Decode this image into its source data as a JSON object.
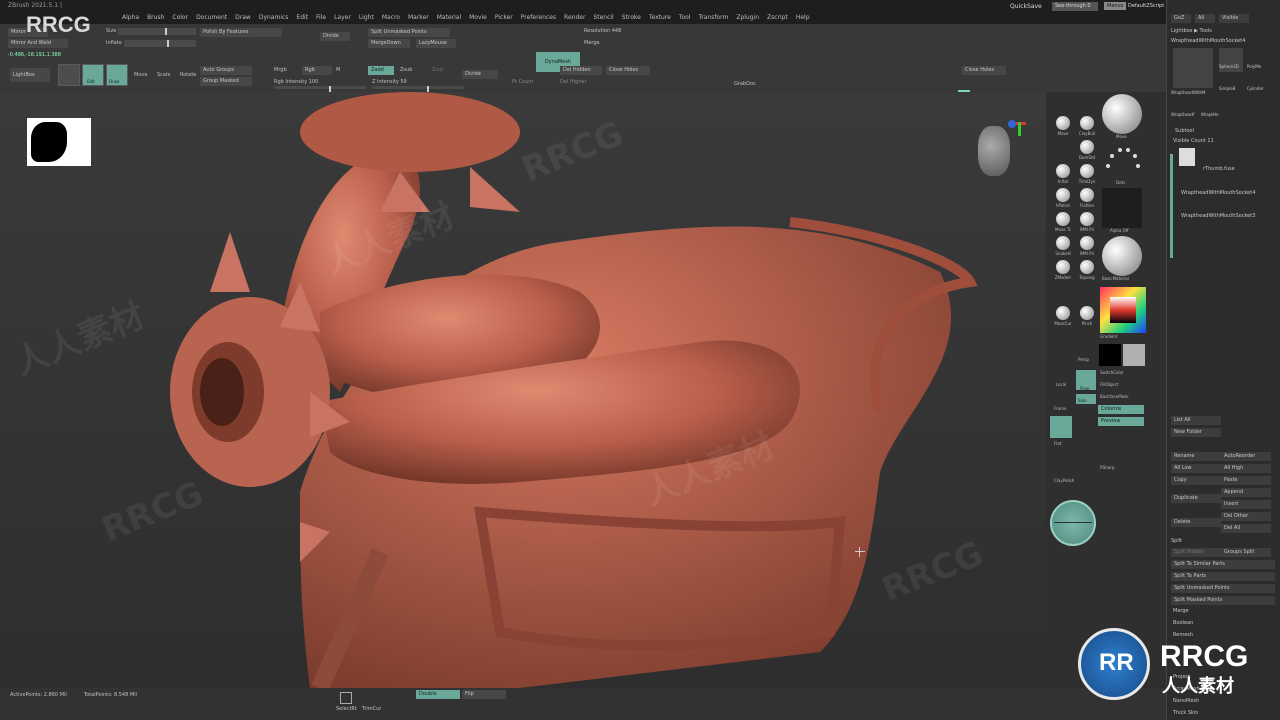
{
  "app": {
    "title": "ZBrush 2021.5.1 |",
    "logo": "RRCG"
  },
  "menus": [
    "Alpha",
    "Brush",
    "Color",
    "Document",
    "Draw",
    "Dynamics",
    "Edit",
    "File",
    "Layer",
    "Light",
    "Macro",
    "Marker",
    "Material",
    "Movie",
    "Picker",
    "Preferences",
    "Render",
    "Stencil",
    "Stroke",
    "Texture",
    "Tool",
    "Transform",
    "Zplugin",
    "Zscript",
    "Help"
  ],
  "header_right": {
    "ac": "AC",
    "quicksave": "QuickSave",
    "seethrough": "See-through  0",
    "menus": "Menus",
    "default_zscript": "DefaultZScript"
  },
  "toolbar": {
    "mirror": "Mirror",
    "mirror_weld": "Mirror And Weld",
    "size": "Size",
    "inflate": "Inflate",
    "polish_features": "Polish By Features",
    "divide_top": "Divide",
    "split_unmasked": "Split Unmasked Points",
    "merge_down": "MergeDown",
    "lazy_mouse": "LazyMouse",
    "dynamesh": "DynaMesh",
    "resolution": "Resolution 448",
    "merge": "Merge",
    "coords": "-0.486,-18.191,1.388",
    "lightbox": "LightBox",
    "edit": "Edit",
    "draw": "Draw",
    "move": "Move",
    "scale": "Scale",
    "rotate": "Rotate",
    "auto_groups": "Auto Groups",
    "group_masked": "Group Masked",
    "mrgb": "Mrgb",
    "rgb": "Rgb",
    "m": "M",
    "zadd": "Zadd",
    "zsub": "Zsub",
    "zcut": "Zcut",
    "rgb_intensity": "Rgb Intensity 100",
    "z_intensity": "Z Intensity 59",
    "divide": "Divide",
    "del_hidden": "Del Hidden",
    "close_holes_mid": "Close Holes",
    "pt_count": "Pt Count",
    "del_higher": "Del Higher",
    "grab_doc": "GrabDoc",
    "close_holes_right": "Close Holes"
  },
  "bottombar": {
    "active_points": "ActivePoints: 2.860 Mil",
    "total_points": "TotalPoints: 8.548 Mil",
    "select_rect": "SelectRt",
    "trim_curve": "TrimCur",
    "double": "Double",
    "flip": "Flip"
  },
  "shelf": {
    "brushes": [
      "Move",
      "ClayBuil",
      "DamStd",
      "Inflat",
      "TrimDyn",
      "hPolish",
      "Flatten",
      "Move Tc",
      "IMM Pri",
      "SnakeH",
      "IMM Pri",
      "ZModelr",
      "Topolog",
      "MaskCur",
      "Pinch"
    ],
    "big_sphere_label": "Move",
    "dots_label": "Dots",
    "alpha_off": "Alpha Off",
    "material": "BasicMaterial",
    "gradient": "Gradient",
    "switch_color": "SwitchColor",
    "fill_object": "FillObject",
    "backface_mask": "BackfaceMask",
    "colorize": "Colorize",
    "preview": "Preview",
    "persp": "Persp",
    "floor": "Floor",
    "local": "Local",
    "frame": "Frame",
    "solo": "Solo",
    "flat": "Flat",
    "clay_polish": "ClayPolish",
    "rsharp": "RSharp",
    "swatch_black": "#000000",
    "swatch_gray": "#b0b0b0"
  },
  "rpanel": {
    "goz": "GoZ",
    "all": "All",
    "visible": "Visible",
    "lightbox_tools": "Lightbox ▶ Tools",
    "current_tool": "WraptheadWithMouthSocket4",
    "sphere3d": "Sphere3D",
    "polymesh": "PolyMe",
    "simplebrush": "SimpleB",
    "cylinder": "Cylinder",
    "thumb_a": "WraptheadWithM",
    "thumb_b": "Wraptheadf",
    "thumb_c": "WraptHe",
    "subtool": "Subtool",
    "visible_count": "Visible Count 11",
    "subtool_1": "rThumb.fuse",
    "subtool_2": "WraptheadWithMouthSocket4",
    "subtool_3": "WraptheadWithMouthSocket3",
    "list_all": "List All",
    "new_folder": "New Folder",
    "rename": "Rename",
    "auto_reorder": "AutoReorder",
    "all_low": "All Low",
    "all_high": "All High",
    "copy": "Copy",
    "paste": "Paste",
    "append": "Append",
    "duplicate": "Duplicate",
    "insert": "Insert",
    "delete": "Delete",
    "del_other": "Del Other",
    "del_all": "Del All",
    "split": "Split",
    "split_hidden": "Split Hidden",
    "groups_split": "Groups Split",
    "split_similar": "Split To Similar Parts",
    "split_parts": "Split To Parts",
    "split_unmasked": "Split Unmasked Points",
    "split_masked": "Split Masked Points",
    "merge": "Merge",
    "boolean": "Boolean",
    "remesh": "Remesh",
    "project": "Project",
    "array_mesh": "ArrayMesh",
    "nano_mesh": "NanoMesh",
    "thick_skin": "Thick Skin"
  },
  "watermark": {
    "latin": "RRCG",
    "cjk": "人人素材",
    "badge_text": "RRCG",
    "badge_sub": "人人素材"
  },
  "colors": {
    "accent": "#6aa89a",
    "model": "#c06a55",
    "background": "#2a2a2a"
  }
}
